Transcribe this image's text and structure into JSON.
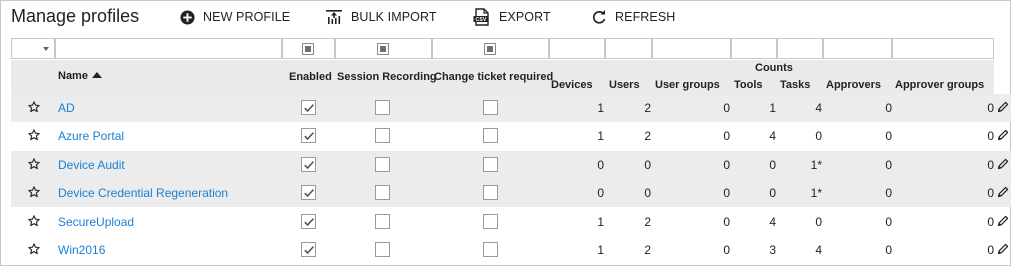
{
  "page": {
    "title": "Manage profiles"
  },
  "toolbar": {
    "new_profile": "NEW PROFILE",
    "bulk_import": "BULK IMPORT",
    "export": "EXPORT",
    "refresh": "REFRESH"
  },
  "columns": {
    "name": "Name",
    "enabled": "Enabled",
    "session_recording": "Session Recording",
    "change_ticket": "Change ticket required",
    "devices": "Devices",
    "users": "Users",
    "user_groups": "User groups",
    "counts": "Counts",
    "tools": "Tools",
    "tasks": "Tasks",
    "approvers": "Approvers",
    "approver_groups": "Approver groups"
  },
  "rows": [
    {
      "name": "AD",
      "enabled": true,
      "session_recording": false,
      "change_ticket": false,
      "devices": "1",
      "users": "2",
      "user_groups": "0",
      "tools": "1",
      "tasks": "4",
      "approvers": "0",
      "approver_groups": "0"
    },
    {
      "name": "Azure Portal",
      "enabled": true,
      "session_recording": false,
      "change_ticket": false,
      "devices": "1",
      "users": "2",
      "user_groups": "0",
      "tools": "4",
      "tasks": "0",
      "approvers": "0",
      "approver_groups": "0"
    },
    {
      "name": "Device Audit",
      "enabled": true,
      "session_recording": false,
      "change_ticket": false,
      "devices": "0",
      "users": "0",
      "user_groups": "0",
      "tools": "0",
      "tasks": "1*",
      "approvers": "0",
      "approver_groups": "0"
    },
    {
      "name": "Device Credential Regeneration",
      "enabled": true,
      "session_recording": false,
      "change_ticket": false,
      "devices": "0",
      "users": "0",
      "user_groups": "0",
      "tools": "0",
      "tasks": "1*",
      "approvers": "0",
      "approver_groups": "0"
    },
    {
      "name": "SecureUpload",
      "enabled": true,
      "session_recording": false,
      "change_ticket": false,
      "devices": "1",
      "users": "2",
      "user_groups": "0",
      "tools": "4",
      "tasks": "0",
      "approvers": "0",
      "approver_groups": "0"
    },
    {
      "name": "Win2016",
      "enabled": true,
      "session_recording": false,
      "change_ticket": false,
      "devices": "1",
      "users": "2",
      "user_groups": "0",
      "tools": "3",
      "tasks": "4",
      "approvers": "0",
      "approver_groups": "0"
    }
  ],
  "colors": {
    "link": "#1a7fd6",
    "header_bg": "#eaeaea",
    "alt_row_bg": "#ececec"
  },
  "icons": {
    "new_profile": "plus-circle-icon",
    "bulk_import": "bulk-import-icon",
    "export": "csv-file-icon",
    "refresh": "refresh-icon",
    "favorite": "star-outline-icon",
    "edit": "pencil-icon"
  }
}
